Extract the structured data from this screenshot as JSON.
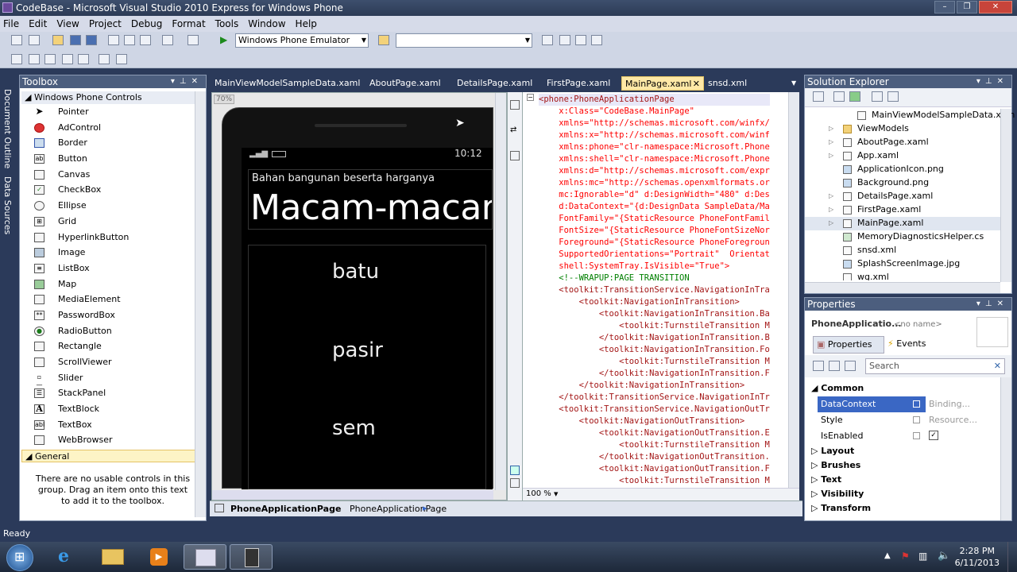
{
  "window": {
    "title": "CodeBase - Microsoft Visual Studio 2010 Express for Windows Phone"
  },
  "menu": [
    "File",
    "Edit",
    "View",
    "Project",
    "Debug",
    "Format",
    "Tools",
    "Window",
    "Help"
  ],
  "toolbar": {
    "target_device": "Windows Phone Emulator",
    "config_combo": ""
  },
  "left_strip": {
    "tabs": [
      "Document Outline",
      "Data Sources"
    ]
  },
  "toolbox": {
    "title": "Toolbox",
    "group": "Windows Phone Controls",
    "items": [
      "Pointer",
      "AdControl",
      "Border",
      "Button",
      "Canvas",
      "CheckBox",
      "Ellipse",
      "Grid",
      "HyperlinkButton",
      "Image",
      "ListBox",
      "Map",
      "MediaElement",
      "PasswordBox",
      "RadioButton",
      "Rectangle",
      "ScrollViewer",
      "Slider",
      "StackPanel",
      "TextBlock",
      "TextBox",
      "WebBrowser"
    ],
    "general_group": "General",
    "empty_note": "There are no usable controls in this group. Drag an item onto this text to add it to the toolbox."
  },
  "doc_tabs": [
    "MainViewModelSampleData.xaml",
    "AboutPage.xaml",
    "DetailsPage.xaml",
    "FirstPage.xaml",
    "MainPage.xaml",
    "snsd.xml"
  ],
  "active_tab": "MainPage.xaml",
  "designer": {
    "zoom": "70%",
    "phone_time": "10:12",
    "app_title": "Bahan bangunan beserta harganya",
    "page_title": "Macam-macam",
    "list": [
      "batu",
      "pasir",
      "sem"
    ]
  },
  "code_lines": [
    "<phone:PhoneApplicationPage",
    "    x:Class=\"CodeBase.MainPage\"",
    "    xmlns=\"http://schemas.microsoft.com/winfx/",
    "    xmlns:x=\"http://schemas.microsoft.com/winf",
    "    xmlns:phone=\"clr-namespace:Microsoft.Phone",
    "    xmlns:shell=\"clr-namespace:Microsoft.Phone",
    "    xmlns:d=\"http://schemas.microsoft.com/expr",
    "    xmlns:mc=\"http://schemas.openxmlformats.or",
    "    mc:Ignorable=\"d\" d:DesignWidth=\"480\" d:Des",
    "    d:DataContext=\"{d:DesignData SampleData/Ma",
    "    FontFamily=\"{StaticResource PhoneFontFamil",
    "    FontSize=\"{StaticResource PhoneFontSizeNor",
    "    Foreground=\"{StaticResource PhoneForegroun",
    "    SupportedOrientations=\"Portrait\"  Orientat",
    "    shell:SystemTray.IsVisible=\"True\">",
    "    <!--WRAPUP:PAGE TRANSITION",
    "    <toolkit:TransitionService.NavigationInTra",
    "        <toolkit:NavigationInTransition>",
    "            <toolkit:NavigationInTransition.Ba",
    "                <toolkit:TurnstileTransition M",
    "            </toolkit:NavigationInTransition.B",
    "            <toolkit:NavigationInTransition.Fo",
    "                <toolkit:TurnstileTransition M",
    "            </toolkit:NavigationInTransition.F",
    "        </toolkit:NavigationInTransition>",
    "    </toolkit:TransitionService.NavigationInTr",
    "    <toolkit:TransitionService.NavigationOutTr",
    "        <toolkit:NavigationOutTransition>",
    "            <toolkit:NavigationOutTransition.E",
    "                <toolkit:TurnstileTransition M",
    "            </toolkit:NavigationOutTransition.",
    "            <toolkit:NavigationOutTransition.F",
    "                <toolkit:TurnstileTransition M"
  ],
  "code_zoom": "100 %",
  "breadcrumb": [
    "PhoneApplicationPage",
    "PhoneApplicationPage"
  ],
  "solution_explorer": {
    "title": "Solution Explorer",
    "items": [
      "MainViewModelSampleData.xam",
      "ViewModels",
      "AboutPage.xaml",
      "App.xaml",
      "ApplicationIcon.png",
      "Background.png",
      "DetailsPage.xaml",
      "FirstPage.xaml",
      "MainPage.xaml",
      "MemoryDiagnosticsHelper.cs",
      "snsd.xml",
      "SplashScreenImage.jpg",
      "wg.xml"
    ]
  },
  "properties": {
    "title": "Properties",
    "object": "PhoneApplicatio...",
    "no_name": "<no name>",
    "tab_properties": "Properties",
    "tab_events": "Events",
    "search_placeholder": "Search",
    "sections": [
      "Common",
      "Layout",
      "Brushes",
      "Text",
      "Visibility",
      "Transform"
    ],
    "rows": [
      {
        "name": "DataContext",
        "value": "Binding..."
      },
      {
        "name": "Style",
        "value": "Resource..."
      },
      {
        "name": "IsEnabled",
        "value": "✓"
      }
    ]
  },
  "status": "Ready",
  "clock": {
    "time": "2:28 PM",
    "date": "6/11/2013"
  }
}
